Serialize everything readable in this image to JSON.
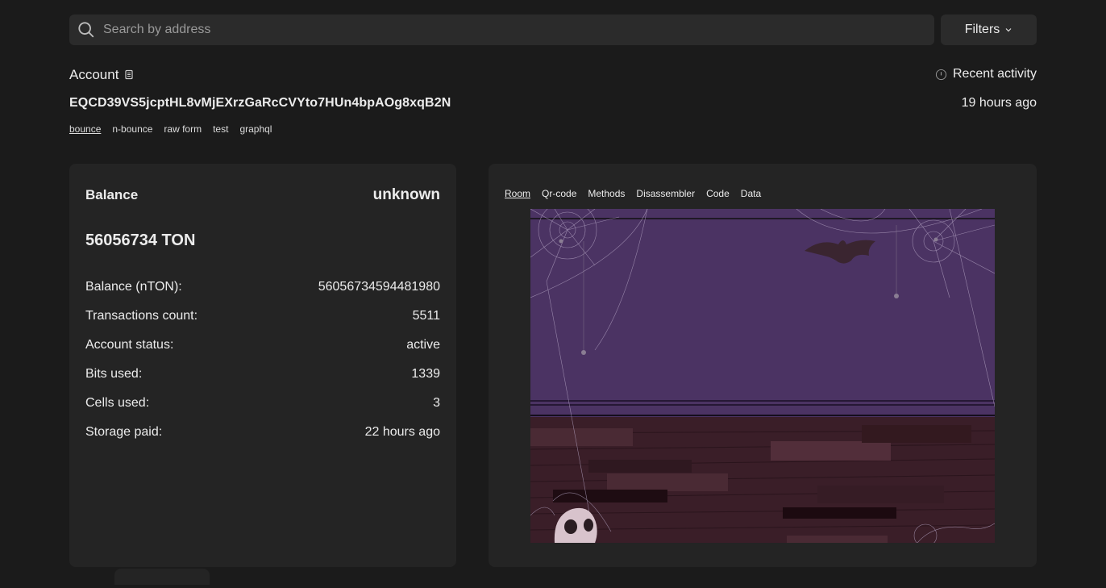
{
  "search": {
    "placeholder": "Search by address"
  },
  "filters": {
    "label": "Filters"
  },
  "account": {
    "title": "Account",
    "address": "EQCD39VS5jcptHL8vMjEXrzGaRcCVYto7HUn4bpAOg8xqB2N",
    "links": [
      "bounce",
      "n-bounce",
      "raw form",
      "test",
      "graphql"
    ],
    "active_link": "bounce"
  },
  "recent": {
    "label": "Recent activity",
    "time": "19 hours ago"
  },
  "balance": {
    "label": "Balance",
    "state": "unknown",
    "amount": "56056734 TON",
    "rows": [
      {
        "label": "Balance (nTON):",
        "value": "56056734594481980"
      },
      {
        "label": "Transactions count:",
        "value": "5511"
      },
      {
        "label": "Account status:",
        "value": "active"
      },
      {
        "label": "Bits used:",
        "value": "1339"
      },
      {
        "label": "Cells used:",
        "value": "3"
      },
      {
        "label": "Storage paid:",
        "value": "22 hours ago"
      }
    ]
  },
  "tabs": [
    "Room",
    "Qr-code",
    "Methods",
    "Disassembler",
    "Code",
    "Data"
  ],
  "active_tab": "Room",
  "icons": {
    "search": "search-icon",
    "filters": "chevron-down-icon",
    "copy": "copy-icon",
    "recent": "info-icon"
  },
  "colors": {
    "background": "#1b1b1b",
    "card": "#242424",
    "input": "#2b2b2b",
    "room_wall": "#4b3363",
    "room_floor": "#3a1e28"
  }
}
